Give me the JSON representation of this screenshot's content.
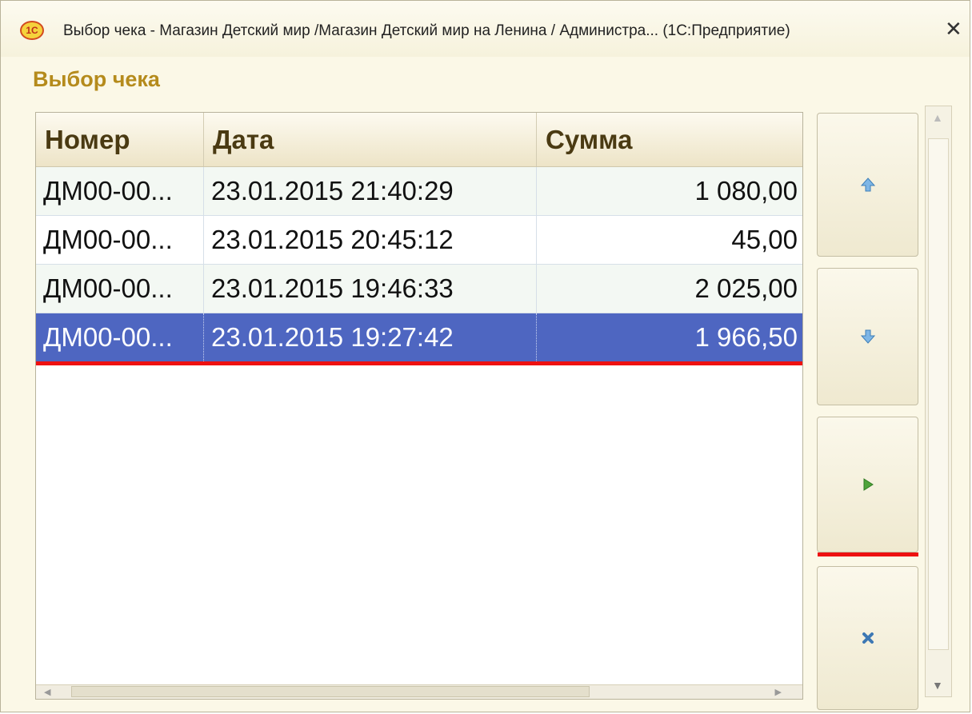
{
  "window": {
    "title": "Выбор чека - Магазин Детский мир /Магазин Детский мир на Ленина / Администра... (1С:Предприятие)",
    "logo_text": "1C",
    "close_glyph": "✕"
  },
  "form": {
    "title": "Выбор чека"
  },
  "table": {
    "columns": [
      "Номер",
      "Дата",
      "Сумма"
    ],
    "rows": [
      {
        "number": "ДМ00-00...",
        "date": "23.01.2015 21:40:29",
        "sum": "1 080,00"
      },
      {
        "number": "ДМ00-00...",
        "date": "23.01.2015 20:45:12",
        "sum": "45,00"
      },
      {
        "number": "ДМ00-00...",
        "date": "23.01.2015 19:46:33",
        "sum": "2 025,00"
      },
      {
        "number": "ДМ00-00...",
        "date": "23.01.2015 19:27:42",
        "sum": "1 966,50",
        "selected": true
      }
    ]
  },
  "buttons": [
    {
      "name": "move-up-button",
      "icon": "arrow-up-icon"
    },
    {
      "name": "move-down-button",
      "icon": "arrow-down-icon"
    },
    {
      "name": "select-button",
      "icon": "play-icon"
    },
    {
      "name": "cancel-button",
      "icon": "close-icon"
    }
  ],
  "colors": {
    "selection": "#4e66c1",
    "highlight_line": "#ee1111",
    "form_title": "#b58b1c"
  }
}
